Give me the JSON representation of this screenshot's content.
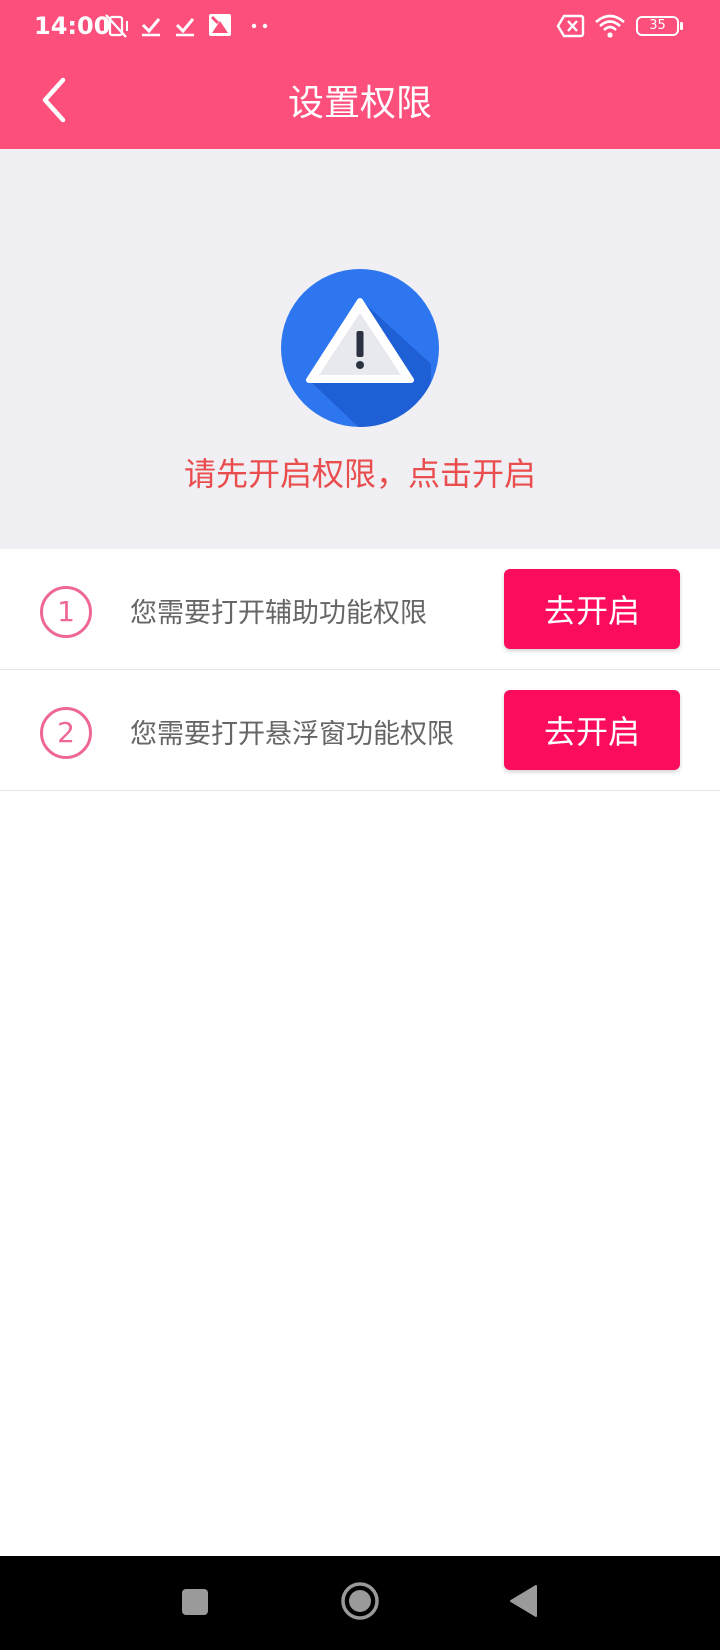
{
  "status_bar": {
    "time": "14:00",
    "battery": "35",
    "icons": [
      "mute-vibrate-icon",
      "check-icon",
      "check-icon",
      "app-icon",
      "more-dots-icon",
      "sim-off-icon",
      "wifi-icon",
      "battery-icon"
    ]
  },
  "header": {
    "title": "设置权限",
    "back_icon": "chevron-left-icon",
    "background": "#fd4f7c"
  },
  "warning": {
    "icon": "warning-triangle-icon",
    "message": "请先开启权限，点击开启",
    "message_color": "#ea4d4d"
  },
  "permissions": [
    {
      "step": "1",
      "text": "您需要打开辅助功能权限",
      "button": "去开启"
    },
    {
      "step": "2",
      "text": "您需要打开悬浮窗功能权限",
      "button": "去开启"
    }
  ],
  "colors": {
    "accent_button": "#fb0c5c",
    "step_circle": "#ee6893",
    "panel_bg": "#efeff4"
  },
  "nav_bar": {
    "buttons": [
      "recent-apps-icon",
      "home-icon",
      "back-triangle-icon"
    ]
  }
}
